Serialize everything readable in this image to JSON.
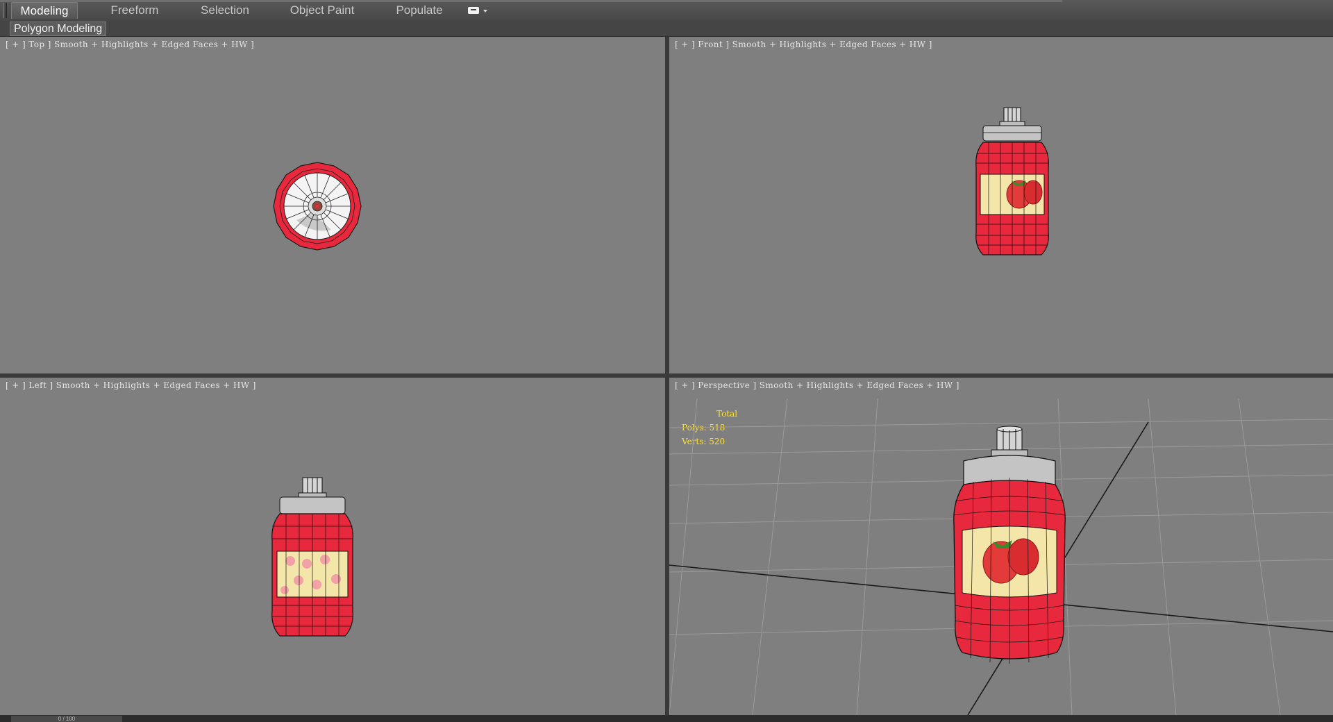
{
  "ribbon": {
    "tabs": [
      {
        "label": "Modeling",
        "active": true
      },
      {
        "label": "Freeform",
        "active": false
      },
      {
        "label": "Selection",
        "active": false
      },
      {
        "label": "Object Paint",
        "active": false
      },
      {
        "label": "Populate",
        "active": false
      }
    ],
    "options_icon": "ribbon-options-icon"
  },
  "subribbon": {
    "panel_label": "Polygon Modeling"
  },
  "viewports": {
    "top": {
      "label": "[ + ] Top ] Smooth + Highlights + Edged Faces + HW ]"
    },
    "front": {
      "label": "[ + ] Front ] Smooth + Highlights + Edged Faces + HW ]"
    },
    "left": {
      "label": "[ + ] Left ] Smooth + Highlights + Edged Faces + HW ]"
    },
    "perspective": {
      "label": "[ + ] Perspective ] Smooth + Highlights + Edged Faces + HW ]",
      "stats": {
        "title": "Total",
        "polys": "Polys: 518",
        "verts": "Verts: 520"
      }
    }
  },
  "statusbar": {
    "time_slider": "0 / 100"
  },
  "colors": {
    "viewport_bg": "#7f7f7f",
    "jar_red": "#e8283c",
    "jar_cap": "#c4c4c4",
    "label_cream": "#f3e6a8",
    "stats_text": "#ffe030"
  }
}
